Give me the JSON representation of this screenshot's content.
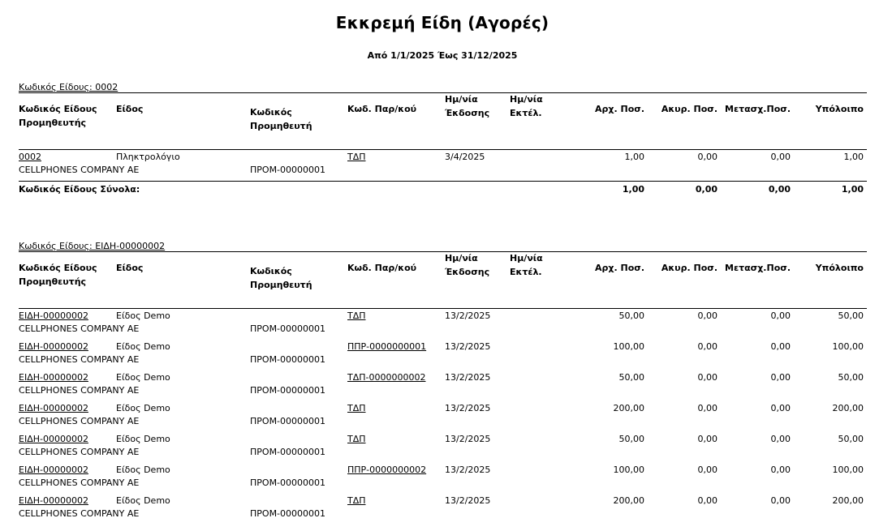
{
  "report": {
    "title": "Εκκρεμή Είδη (Αγορές)",
    "subtitle": "Από 1/1/2025 Έως 31/12/2025"
  },
  "columns": {
    "supplier_item_code": "Κωδικός Είδους\nΠρομηθευτής",
    "item": "Είδος",
    "supplier_code": "Κωδικός\nΠρομηθευτή",
    "doc_code": "Κωδ. Παρ/κού",
    "issue_date": "Ημ/νία\nΈκδοσης",
    "exec_date": "Ημ/νία\nΕκτέλ.",
    "orig_qty": "Αρχ. Ποσ.",
    "cancel_qty": "Ακυρ. Ποσ.",
    "transf_qty": "Μετασχ.Ποσ.",
    "balance": "Υπόλοιπο"
  },
  "groups": [
    {
      "label": "Κωδικός Είδους: 0002",
      "rows": [
        {
          "item_code": "0002",
          "item": "Πληκτρολόγιο",
          "supplier_name": "CELLPHONES COMPANY AE",
          "supplier_code": "ΠΡΟΜ-00000001",
          "doc_code": "ΤΔΠ",
          "issue_date": "3/4/2025",
          "orig_qty": "1,00",
          "cancel_qty": "0,00",
          "transf_qty": "0,00",
          "balance": "1,00"
        }
      ],
      "totals": {
        "label": "Κωδικός Είδους Σύνολα:",
        "orig_qty": "1,00",
        "cancel_qty": "0,00",
        "transf_qty": "0,00",
        "balance": "1,00"
      }
    },
    {
      "label": "Κωδικός Είδους: ΕΙΔΗ-00000002",
      "rows": [
        {
          "item_code": "ΕΙΔΗ-00000002",
          "item": "Είδος Demo",
          "supplier_name": "CELLPHONES COMPANY AE",
          "supplier_code": "ΠΡΟΜ-00000001",
          "doc_code": "ΤΔΠ",
          "issue_date": "13/2/2025",
          "orig_qty": "50,00",
          "cancel_qty": "0,00",
          "transf_qty": "0,00",
          "balance": "50,00"
        },
        {
          "item_code": "ΕΙΔΗ-00000002",
          "item": "Είδος Demo",
          "supplier_name": "CELLPHONES COMPANY AE",
          "supplier_code": "ΠΡΟΜ-00000001",
          "doc_code": "ΠΠΡ-0000000001",
          "issue_date": "13/2/2025",
          "orig_qty": "100,00",
          "cancel_qty": "0,00",
          "transf_qty": "0,00",
          "balance": "100,00"
        },
        {
          "item_code": "ΕΙΔΗ-00000002",
          "item": "Είδος Demo",
          "supplier_name": "CELLPHONES COMPANY AE",
          "supplier_code": "ΠΡΟΜ-00000001",
          "doc_code": "ΤΔΠ-0000000002",
          "issue_date": "13/2/2025",
          "orig_qty": "50,00",
          "cancel_qty": "0,00",
          "transf_qty": "0,00",
          "balance": "50,00"
        },
        {
          "item_code": "ΕΙΔΗ-00000002",
          "item": "Είδος Demo",
          "supplier_name": "CELLPHONES COMPANY AE",
          "supplier_code": "ΠΡΟΜ-00000001",
          "doc_code": "ΤΔΠ",
          "issue_date": "13/2/2025",
          "orig_qty": "200,00",
          "cancel_qty": "0,00",
          "transf_qty": "0,00",
          "balance": "200,00"
        },
        {
          "item_code": "ΕΙΔΗ-00000002",
          "item": "Είδος Demo",
          "supplier_name": "CELLPHONES COMPANY AE",
          "supplier_code": "ΠΡΟΜ-00000001",
          "doc_code": "ΤΔΠ",
          "issue_date": "13/2/2025",
          "orig_qty": "50,00",
          "cancel_qty": "0,00",
          "transf_qty": "0,00",
          "balance": "50,00"
        },
        {
          "item_code": "ΕΙΔΗ-00000002",
          "item": "Είδος Demo",
          "supplier_name": "CELLPHONES COMPANY AE",
          "supplier_code": "ΠΡΟΜ-00000001",
          "doc_code": "ΠΠΡ-0000000002",
          "issue_date": "13/2/2025",
          "orig_qty": "100,00",
          "cancel_qty": "0,00",
          "transf_qty": "0,00",
          "balance": "100,00"
        },
        {
          "item_code": "ΕΙΔΗ-00000002",
          "item": "Είδος Demo",
          "supplier_name": "CELLPHONES COMPANY AE",
          "supplier_code": "ΠΡΟΜ-00000001",
          "doc_code": "ΤΔΠ",
          "issue_date": "13/2/2025",
          "orig_qty": "200,00",
          "cancel_qty": "0,00",
          "transf_qty": "0,00",
          "balance": "200,00"
        }
      ]
    }
  ]
}
